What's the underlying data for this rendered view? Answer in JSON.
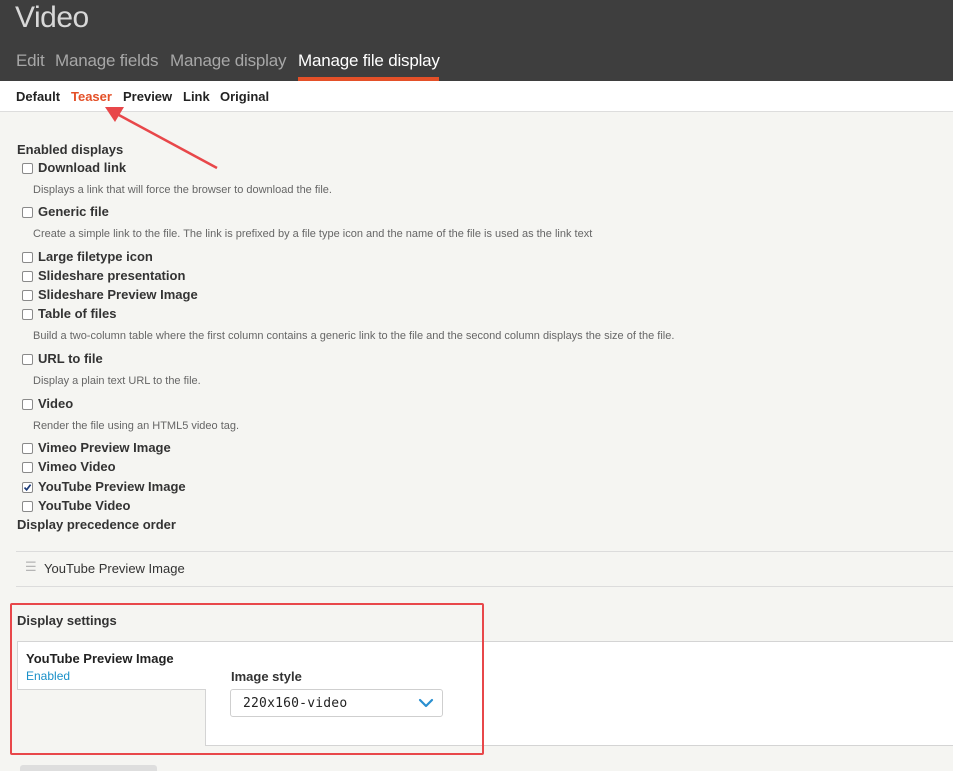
{
  "page": {
    "title": "Video"
  },
  "tabs": [
    {
      "label": "Edit",
      "active": false
    },
    {
      "label": "Manage fields",
      "active": false
    },
    {
      "label": "Manage display",
      "active": false
    },
    {
      "label": "Manage file display",
      "active": true
    }
  ],
  "subtabs": [
    {
      "label": "Default",
      "active": false
    },
    {
      "label": "Teaser",
      "active": true
    },
    {
      "label": "Preview",
      "active": false
    },
    {
      "label": "Link",
      "active": false
    },
    {
      "label": "Original",
      "active": false
    }
  ],
  "enabled_displays": {
    "label": "Enabled displays",
    "items": [
      {
        "label": "Download link",
        "checked": false,
        "description": "Displays a link that will force the browser to download the file."
      },
      {
        "label": "Generic file",
        "checked": false,
        "description": "Create a simple link to the file. The link is prefixed by a file type icon and the name of the file is used as the link text"
      },
      {
        "label": "Large filetype icon",
        "checked": false
      },
      {
        "label": "Slideshare presentation",
        "checked": false
      },
      {
        "label": "Slideshare Preview Image",
        "checked": false
      },
      {
        "label": "Table of files",
        "checked": false,
        "description": "Build a two-column table where the first column contains a generic link to the file and the second column displays the size of the file."
      },
      {
        "label": "URL to file",
        "checked": false,
        "description": "Display a plain text URL to the file."
      },
      {
        "label": "Video",
        "checked": false,
        "description": "Render the file using an HTML5 video tag."
      },
      {
        "label": "Vimeo Preview Image",
        "checked": false
      },
      {
        "label": "Vimeo Video",
        "checked": false
      },
      {
        "label": "YouTube Preview Image",
        "checked": true
      },
      {
        "label": "YouTube Video",
        "checked": false
      }
    ]
  },
  "precedence": {
    "label": "Display precedence order",
    "items": [
      {
        "label": "YouTube Preview Image",
        "icon": "drag-handle-icon"
      }
    ]
  },
  "display_settings": {
    "label": "Display settings",
    "vertical_tab": {
      "title": "YouTube Preview Image",
      "summary": "Enabled"
    },
    "image_style": {
      "label": "Image style",
      "value": "220x160-video"
    }
  },
  "colors": {
    "header_bg": "#3e3e3e",
    "accent": "#e45028",
    "link": "#1a90c8",
    "annotation": "#e8474a"
  }
}
